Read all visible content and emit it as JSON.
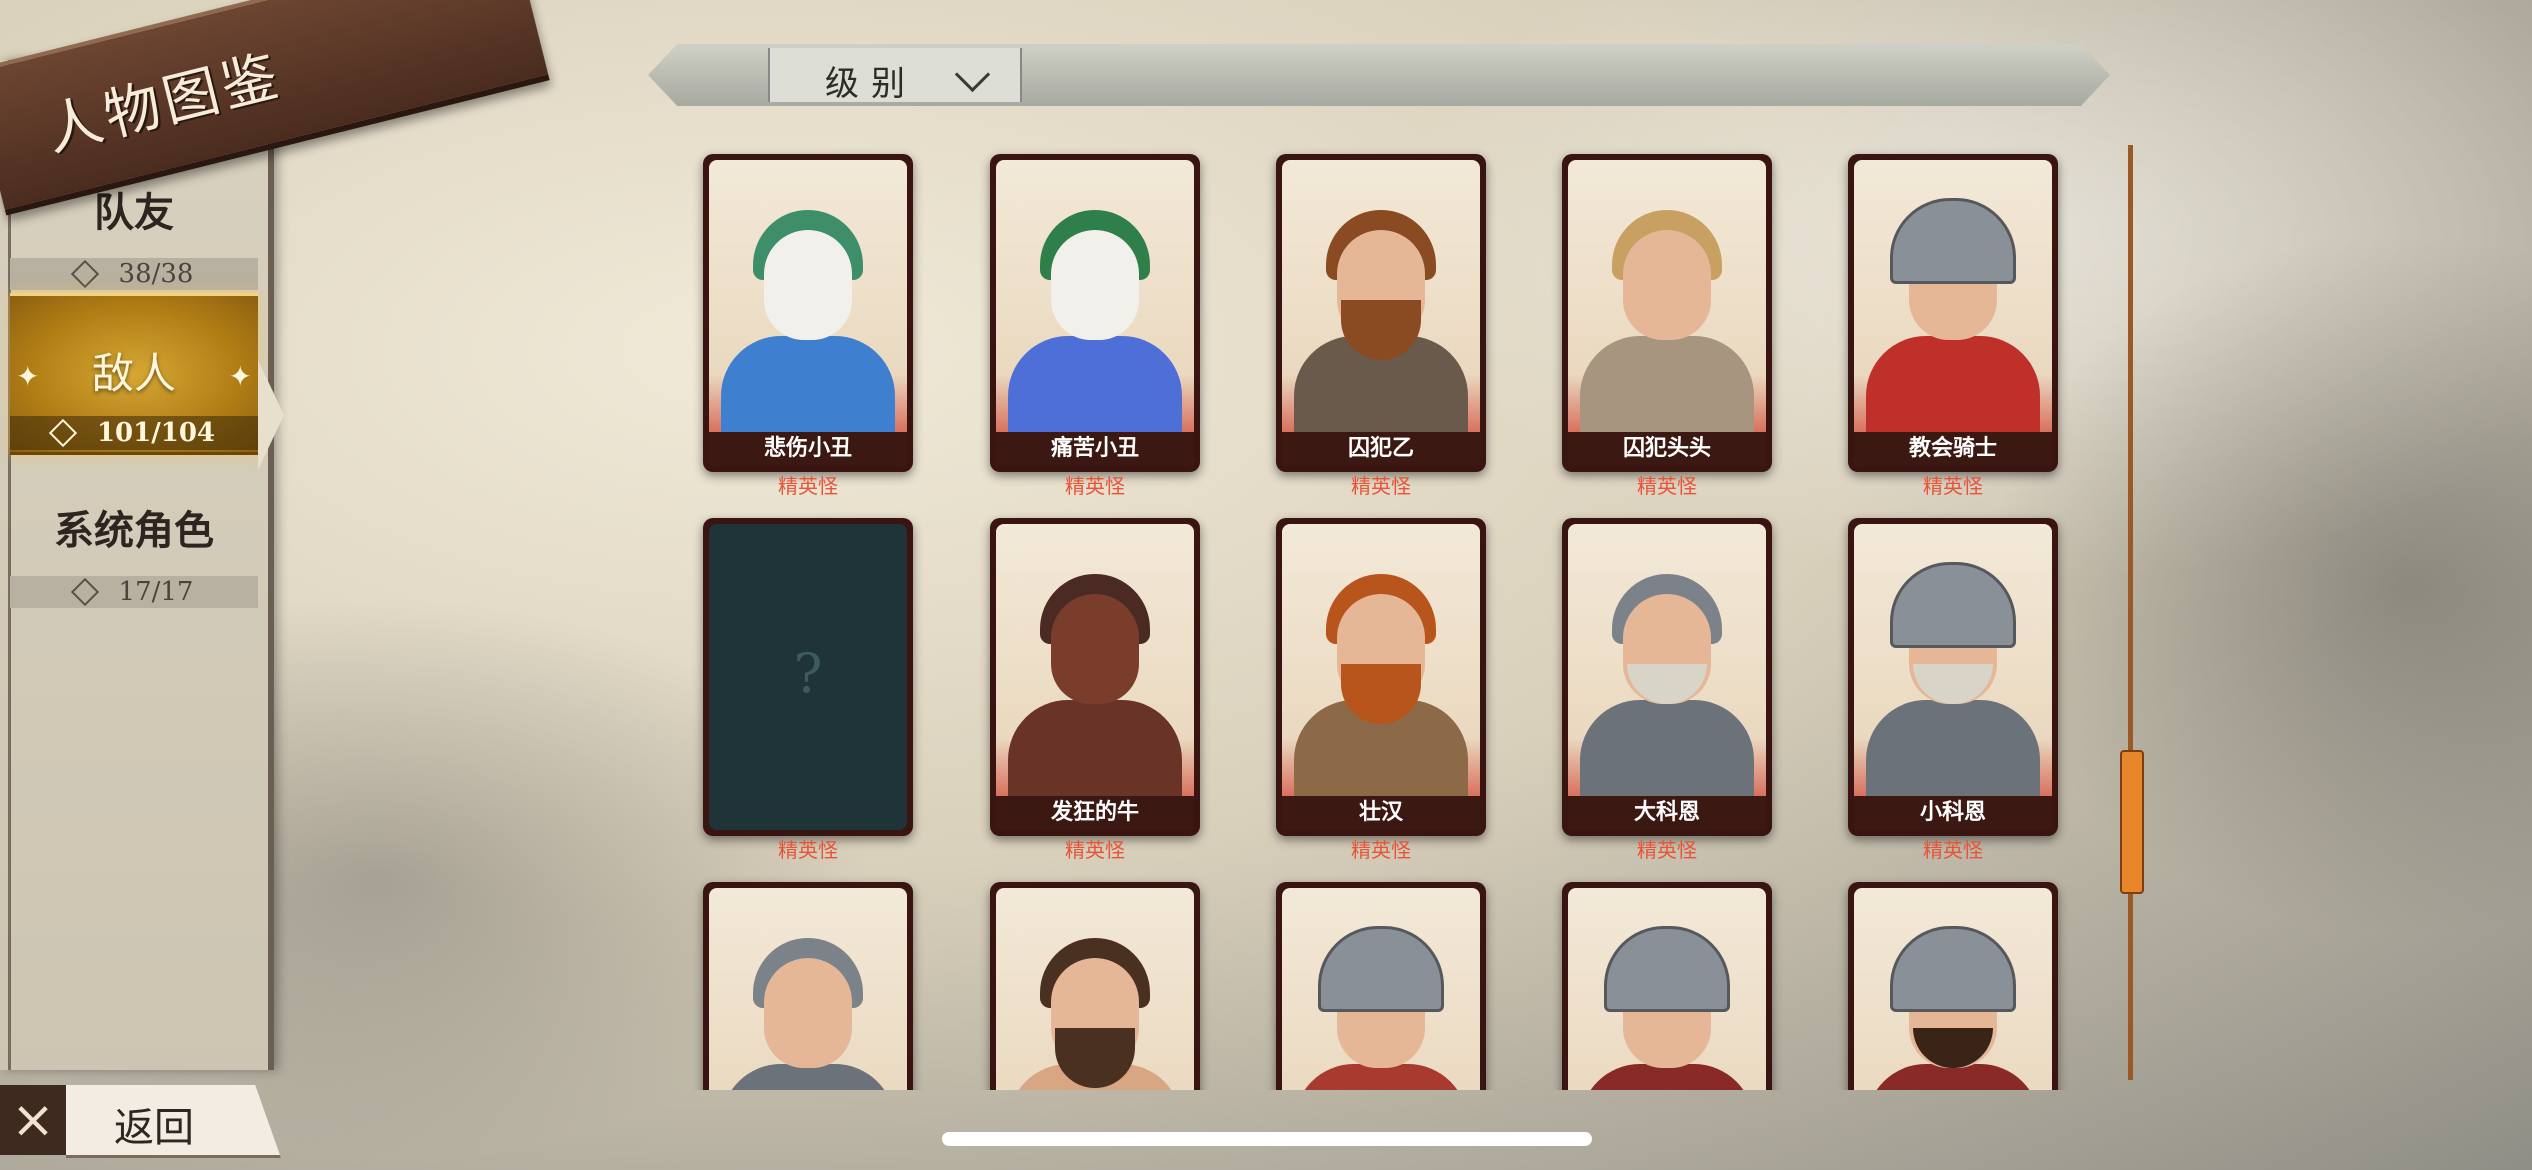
{
  "title": "人物图鉴",
  "sidebar": {
    "items": [
      {
        "label": "队友",
        "count": "38/38"
      },
      {
        "label": "敌人",
        "count": "101/104",
        "active": true
      },
      {
        "label": "系统角色",
        "count": "17/17"
      }
    ]
  },
  "filter": {
    "label": "级别"
  },
  "back": {
    "label": "返回"
  },
  "cards": [
    {
      "name": "悲伤小丑",
      "tier": "精英怪"
    },
    {
      "name": "痛苦小丑",
      "tier": "精英怪"
    },
    {
      "name": "囚犯乙",
      "tier": "精英怪"
    },
    {
      "name": "囚犯头头",
      "tier": "精英怪"
    },
    {
      "name": "教会骑士",
      "tier": "精英怪"
    },
    {
      "name": "",
      "tier": "精英怪",
      "locked_symbol": "?"
    },
    {
      "name": "发狂的牛",
      "tier": "精英怪"
    },
    {
      "name": "壮汉",
      "tier": "精英怪"
    },
    {
      "name": "大科恩",
      "tier": "精英怪"
    },
    {
      "name": "小科恩",
      "tier": "精英怪"
    },
    {
      "name": ""
    },
    {
      "name": ""
    },
    {
      "name": ""
    },
    {
      "name": ""
    },
    {
      "name": ""
    }
  ],
  "colors": {
    "accent_gold": "#d6a734",
    "tier_red": "#e8543a",
    "scroll_orange": "#e9862b"
  }
}
